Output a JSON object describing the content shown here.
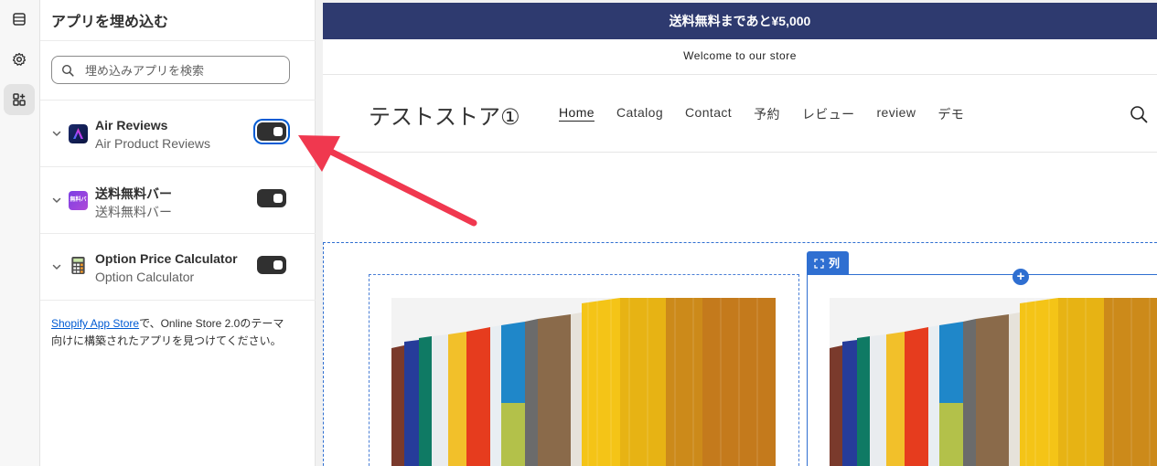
{
  "panel": {
    "title": "アプリを埋め込む",
    "search_placeholder": "埋め込みアプリを検索",
    "apps": [
      {
        "name": "Air Reviews",
        "subtitle": "Air Product Reviews",
        "icon": "air-reviews-logo-icon",
        "enabled": true
      },
      {
        "name": "送料無料バー",
        "subtitle": "送料無料バー",
        "icon": "free-shipping-bar-icon",
        "enabled": true
      },
      {
        "name": "Option Price Calculator",
        "subtitle": "Option Calculator",
        "icon": "calculator-icon",
        "enabled": true
      }
    ],
    "footnote_link": "Shopify App Store",
    "footnote_text": "で、Online Store 2.0のテーマ向けに構築されたアプリを見つけてください。",
    "icon_badge_text": "無料バー"
  },
  "rail": {
    "icons": [
      "sections-icon",
      "settings-gear-icon",
      "app-embed-icon"
    ],
    "active": "app-embed-icon"
  },
  "preview": {
    "announcement": "送料無料まであと¥5,000",
    "welcome": "Welcome to our store",
    "store_name": "テストストア①",
    "nav": [
      "Home",
      "Catalog",
      "Contact",
      "予約",
      "レビュー",
      "review",
      "デモ"
    ],
    "active_nav": "Home",
    "column_tag": "列",
    "add_button": "+"
  },
  "colors": {
    "announcement_bg": "#2e3a6f",
    "selection_blue": "#2f6fd1",
    "arrow_red": "#f0384f",
    "toggle_on": "#303030"
  }
}
